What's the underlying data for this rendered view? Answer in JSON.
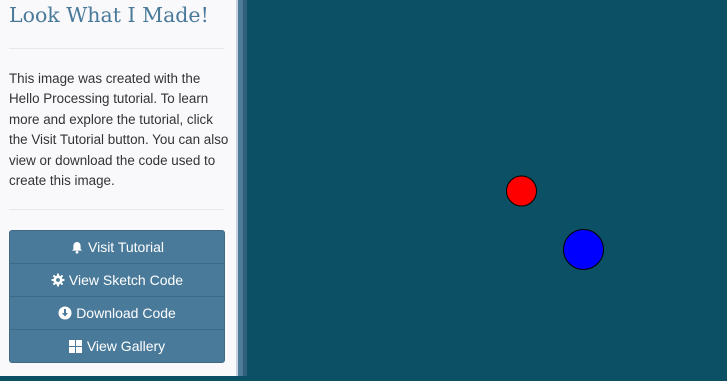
{
  "sidebar": {
    "title": "Look What I Made!",
    "description": "This image was created with the Hello Processing tutorial. To learn more and explore the tutorial, click the Visit Tutorial button. You can also view or download the code used to create this image.",
    "buttons": [
      {
        "label": "Visit Tutorial",
        "icon": "bell-icon"
      },
      {
        "label": "View Sketch Code",
        "icon": "gear-icon"
      },
      {
        "label": "Download Code",
        "icon": "download-icon"
      },
      {
        "label": "View Gallery",
        "icon": "grid-icon"
      }
    ]
  },
  "sketch": {
    "background_color": "#0b5064",
    "circles": [
      {
        "name": "red-circle",
        "color": "#ff0000"
      },
      {
        "name": "blue-circle",
        "color": "#0000ff"
      }
    ]
  },
  "colors": {
    "accent": "#4a7a9a",
    "button_bg": "#4a7a9a"
  }
}
